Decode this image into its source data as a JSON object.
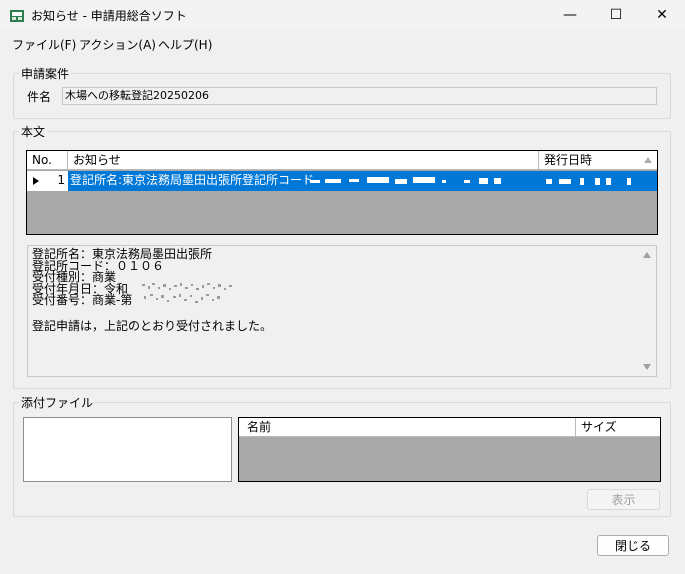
{
  "window": {
    "title": "お知らせ - 申請用総合ソフト",
    "minimize_glyph": "—",
    "maximize_glyph": "☐",
    "close_glyph": "✕"
  },
  "menu": [
    {
      "label": "ファイル(F)"
    },
    {
      "label": "アクション(A)"
    },
    {
      "label": "ヘルプ(H)"
    }
  ],
  "case": {
    "group_label": "申請案件",
    "subject_label": "件名",
    "subject_value": "木場への移転登記20250206"
  },
  "body": {
    "group_label": "本文",
    "grid": {
      "columns": [
        {
          "label": "No."
        },
        {
          "label": "お知らせ"
        },
        {
          "label": "発行日時"
        }
      ],
      "rows": [
        {
          "no": "1",
          "notice": "登記所名:東京法務局墨田出張所登記所コード:"
        }
      ]
    },
    "message_lines": [
      "登記所名：東京法務局墨田出張所",
      "登記所コード：０１０６",
      "受付種別：商業",
      "受付年月日：令和",
      "受付番号：商業-第",
      "",
      "登記申請は，上記のとおり受付されました。"
    ]
  },
  "attachments": {
    "group_label": "添付ファイル",
    "columns": [
      {
        "label": "名前"
      },
      {
        "label": "サイズ"
      }
    ],
    "view_button": "表示"
  },
  "footer": {
    "close_button": "閉じる"
  },
  "colors": {
    "selection": "#0078d7",
    "grid_empty": "#a9a9a9"
  }
}
